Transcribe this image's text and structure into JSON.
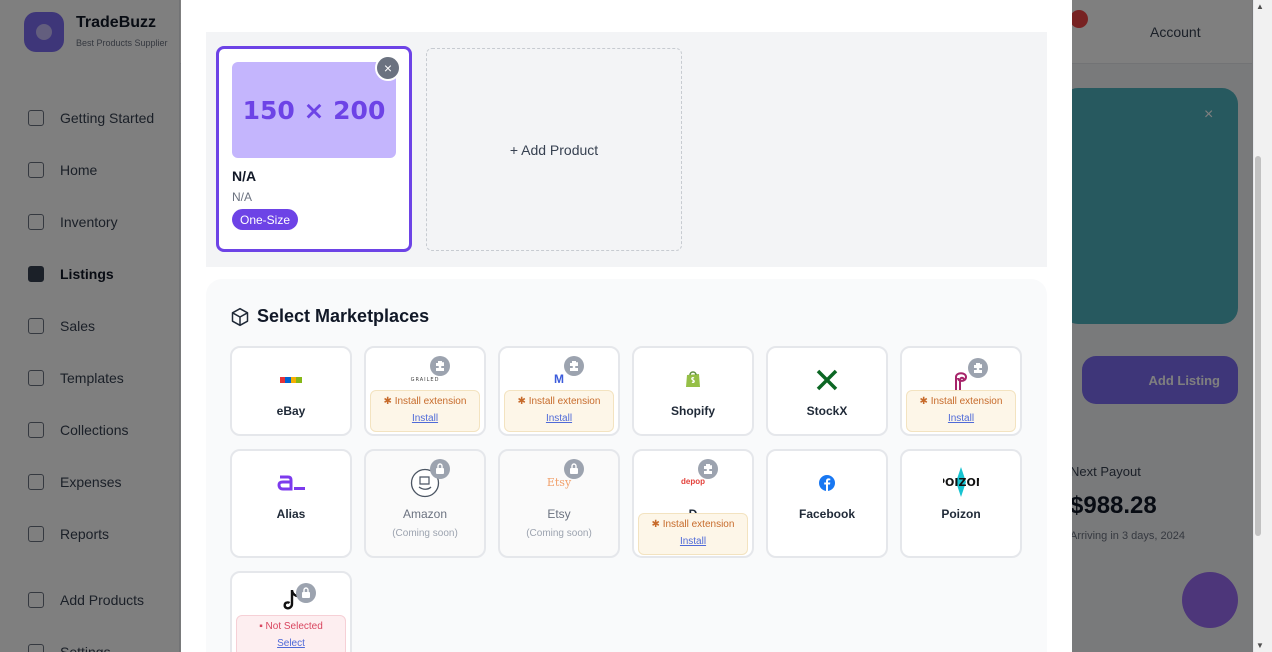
{
  "background": {
    "brand": "TradeBuzz",
    "tagline": "Best Products Supplier",
    "nav": [
      "Getting Started",
      "Home",
      "Inventory",
      "Listings",
      "Sales",
      "Templates",
      "Collections",
      "Expenses",
      "Reports"
    ],
    "nav_lower": [
      "Add Products",
      "Settings"
    ],
    "user": "Account",
    "add_listing": "Add Listing",
    "payout_label": "Next Payout",
    "payout_value": "$988.28",
    "payout_note": "Arriving in 3 days, 2024"
  },
  "products": {
    "items": [
      {
        "image_text": "150 × 200",
        "name": "N/A",
        "sku": "N/A",
        "size": "One-Size",
        "remove": "×"
      }
    ],
    "add_label": "+ Add Product"
  },
  "marketplaces": {
    "title": "Select Marketplaces",
    "items": [
      {
        "id": "ebay",
        "name": "eBay",
        "status": "available",
        "logo_text": "ebay"
      },
      {
        "id": "grailed",
        "name": "",
        "status": "extension",
        "logo_text": "GRAILED",
        "ext_text": "Install extension",
        "ext_link": "Install"
      },
      {
        "id": "mercari",
        "name": "",
        "status": "extension",
        "logo_text": "M",
        "ext_text": "Install extension",
        "ext_link": "Install"
      },
      {
        "id": "shopify",
        "name": "Shopify",
        "status": "available"
      },
      {
        "id": "stockx",
        "name": "StockX",
        "status": "available"
      },
      {
        "id": "poshmark",
        "name": "",
        "status": "extension",
        "ext_text": "Install extension",
        "ext_link": "Install"
      },
      {
        "id": "alias",
        "name": "Alias",
        "status": "available"
      },
      {
        "id": "amazon",
        "name": "Amazon",
        "status": "locked",
        "note": "(Coming soon)"
      },
      {
        "id": "etsy",
        "name": "Etsy",
        "status": "locked",
        "logo_text": "Etsy",
        "note": "(Coming soon)"
      },
      {
        "id": "depop",
        "name": "D",
        "status": "extension",
        "logo_text": "depop",
        "ext_text": "Install extension",
        "ext_link": "Install"
      },
      {
        "id": "facebook",
        "name": "Facebook",
        "status": "available"
      },
      {
        "id": "poizon",
        "name": "Poizon",
        "status": "available",
        "logo_text": "POIZON"
      },
      {
        "id": "tiktok",
        "name": "",
        "status": "not-selected",
        "ns_text": "Not Selected",
        "ns_link": "Select"
      }
    ]
  },
  "colors": {
    "accent": "#6d43e6",
    "ext_bg": "#fdf6e8",
    "ext_text": "#c76b2b",
    "not_selected_text": "#d9455f",
    "link": "#4f6ad8"
  },
  "icons": {
    "marketplace_title": "box-icon",
    "extension_badge": "puzzle-icon",
    "locked_badge": "lock-icon",
    "remove_product": "close-icon"
  }
}
